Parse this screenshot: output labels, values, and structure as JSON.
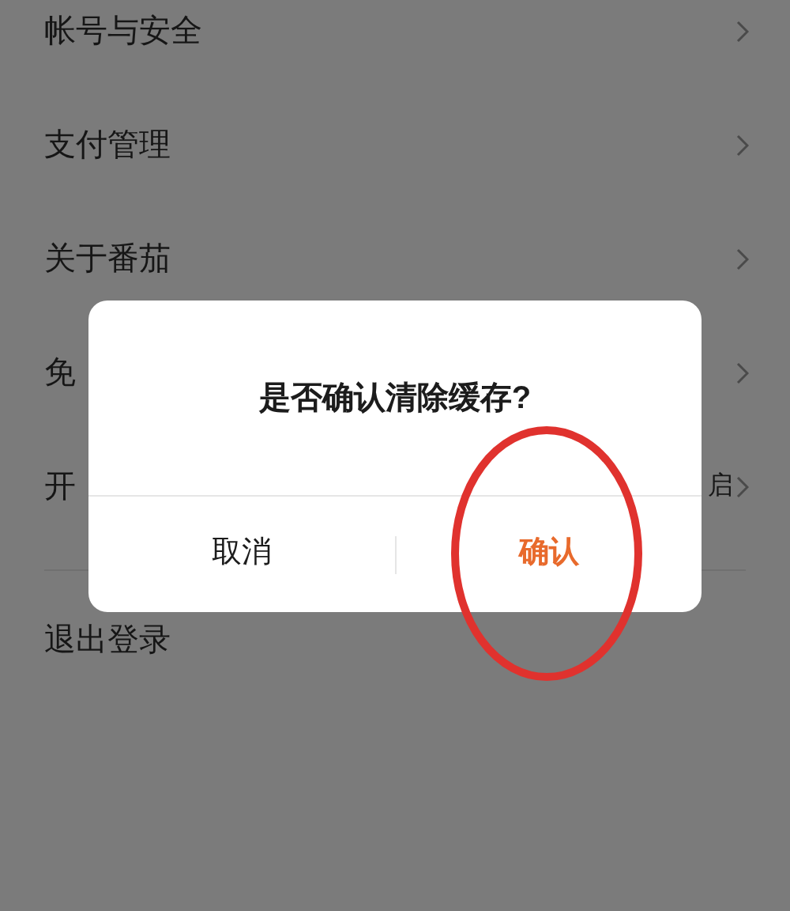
{
  "settings": [
    {
      "label": "帐号与安全",
      "kind": "link"
    },
    {
      "label": "支付管理",
      "kind": "link"
    },
    {
      "label": "关于番茄",
      "kind": "link"
    },
    {
      "label": "免",
      "kind": "link"
    },
    {
      "label": "开",
      "value": "启",
      "kind": "link"
    }
  ],
  "logout": {
    "label": "退出登录"
  },
  "dialog": {
    "title": "是否确认清除缓存?",
    "buttons": [
      {
        "label": "取消",
        "kind": "cancel"
      },
      {
        "label": "确认",
        "kind": "confirm"
      }
    ]
  },
  "annotation": {
    "kind": "ellipse"
  }
}
